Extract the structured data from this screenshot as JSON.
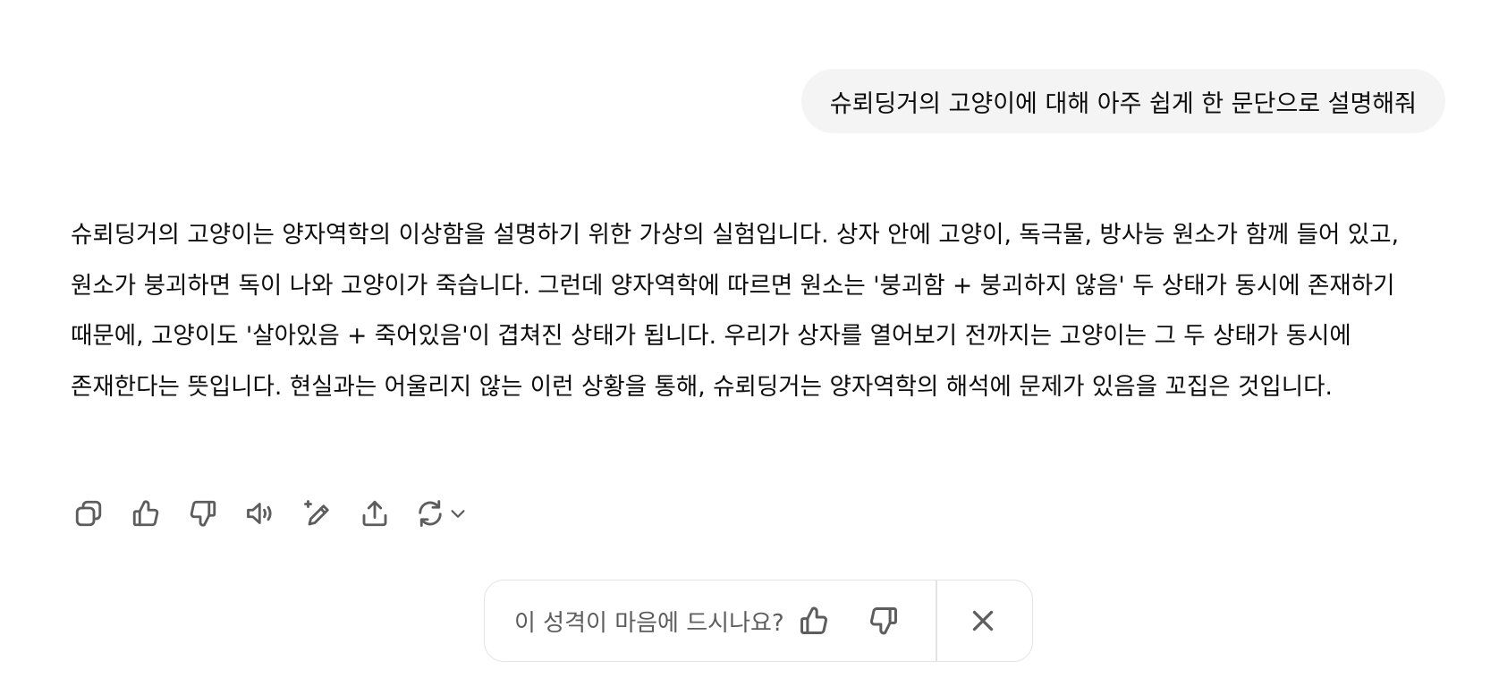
{
  "conversation": {
    "user_message": "슈뢰딩거의 고양이에 대해 아주 쉽게 한 문단으로 설명해줘",
    "assistant_message": "슈뢰딩거의 고양이는 양자역학의 이상함을 설명하기 위한 가상의 실험입니다. 상자 안에 고양이, 독극물, 방사능 원소가 함께 들어 있고, 원소가 붕괴하면 독이 나와 고양이가 죽습니다. 그런데 양자역학에 따르면 원소는 '붕괴함 + 붕괴하지 않음' 두 상태가 동시에 존재하기 때문에, 고양이도 '살아있음 + 죽어있음'이 겹쳐진 상태가 됩니다. 우리가 상자를 열어보기 전까지는 고양이는 그 두 상태가 동시에 존재한다는 뜻입니다. 현실과는 어울리지 않는 이런 상황을 통해, 슈뢰딩거는 양자역학의 해석에 문제가 있음을 꼬집은 것입니다."
  },
  "actions": {
    "icons": [
      "copy-icon",
      "thumbs-up-icon",
      "thumbs-down-icon",
      "read-aloud-icon",
      "edit-sparkle-icon",
      "share-icon",
      "regenerate-icon",
      "chevron-down-icon"
    ]
  },
  "feedback": {
    "question": "이 성격이 마음에 드시나요?",
    "icons": [
      "thumbs-up-icon",
      "thumbs-down-icon",
      "close-icon"
    ]
  },
  "colors": {
    "user_bubble_bg": "#f4f4f4",
    "text": "#0d0d0d",
    "icon": "#5d5d5d",
    "border": "#e3e3e3"
  }
}
